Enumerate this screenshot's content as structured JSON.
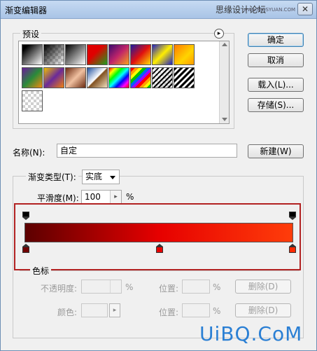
{
  "window": {
    "title": "渐变编辑器",
    "watermark": "思缘设计论坛",
    "watermark_small": "www.MISSYUAN.COM",
    "close_glyph": "✕"
  },
  "presets": {
    "label": "预设",
    "menu_glyph": "▸"
  },
  "buttons": {
    "ok": "确定",
    "cancel": "取消",
    "load": "载入(L)...",
    "save": "存储(S)...",
    "new": "新建(W)"
  },
  "name_field": {
    "label": "名称(N):",
    "value": "自定"
  },
  "gradient_type": {
    "label": "渐变类型(T):",
    "value": "实底"
  },
  "smoothness": {
    "label": "平滑度(M):",
    "value": "100",
    "unit": "%",
    "stepper_glyph": "▸"
  },
  "gradient": {
    "start_color": "#5c0000",
    "mid_color": "#e60000",
    "end_color": "#ff3d0a",
    "highlight_border": "#b22222",
    "color_stops_percent": [
      0,
      50,
      100
    ],
    "opacity_stops_percent": [
      0,
      100
    ]
  },
  "stops_section": {
    "label": "色标",
    "opacity_label": "不透明度:",
    "opacity_unit": "%",
    "location_label": "位置:",
    "location_unit": "%",
    "delete_label": "删除(D)",
    "color_label": "颜色:",
    "color_location_label": "位置:",
    "color_location_unit": "%",
    "color_delete_label": "删除(D)",
    "color_arrow_glyph": "▸"
  },
  "footer_watermark": "UiBQ.CoM",
  "colors": {
    "watermark_blue": "#2a7fd4",
    "stop_mid": "#e60000",
    "stop_end": "#ff2a00",
    "stop_start": "#700000"
  }
}
